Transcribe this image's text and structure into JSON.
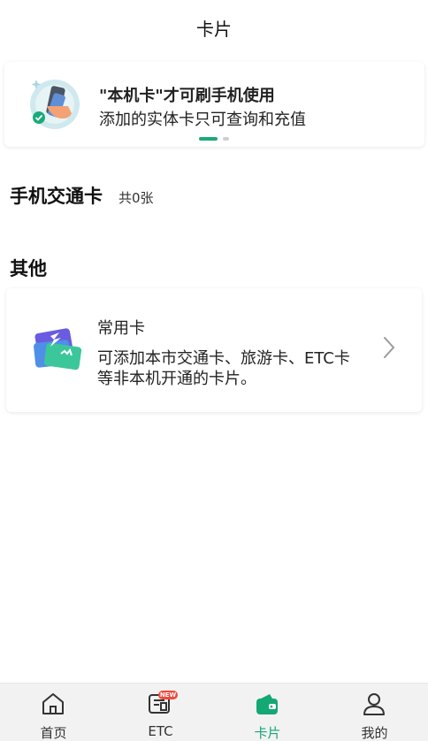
{
  "header": {
    "title": "卡片"
  },
  "banner": {
    "title": "\"本机卡\"才可刷手机使用",
    "subtitle": "添加的实体卡只可查询和充值",
    "page_indicator": {
      "current": 1,
      "total": 2
    }
  },
  "sections": {
    "transit": {
      "title": "手机交通卡",
      "count_label": "共0张"
    },
    "other": {
      "title": "其他",
      "card": {
        "title": "常用卡",
        "description": "可添加本市交通卡、旅游卡、ETC卡等非本机开通的卡片。",
        "chevron_icon": "chevron-right-icon"
      }
    }
  },
  "tabbar": {
    "items": [
      {
        "label": "首页",
        "icon": "home-icon",
        "active": false
      },
      {
        "label": "ETC",
        "icon": "etc-icon",
        "active": false,
        "badge": "NEW"
      },
      {
        "label": "卡片",
        "icon": "wallet-icon",
        "active": true
      },
      {
        "label": "我的",
        "icon": "person-icon",
        "active": false
      }
    ]
  },
  "colors": {
    "accent": "#14a874",
    "badge": "#f04a3e",
    "tabbar_bg": "#f2f2f2"
  }
}
